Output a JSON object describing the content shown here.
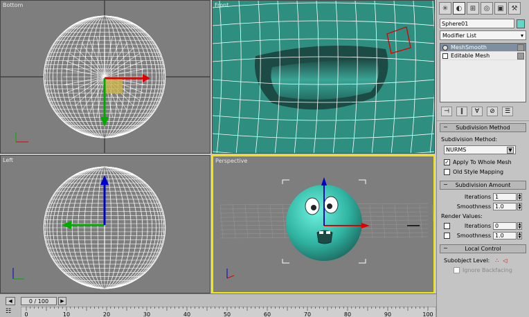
{
  "viewports": {
    "top_left": {
      "label": "Bottom"
    },
    "top_right": {
      "label": "Front"
    },
    "bottom_left": {
      "label": "Left"
    },
    "bottom_right": {
      "label": "Perspective"
    }
  },
  "panel": {
    "tabs": [
      "create-icon",
      "modify-icon",
      "hierarchy-icon",
      "motion-icon",
      "display-icon",
      "utilities-icon"
    ],
    "object_name": "Sphere01",
    "object_color": "#5fd8c8",
    "modifier_list": "Modifier List",
    "stack": [
      {
        "label": "MeshSmooth",
        "selected": true
      },
      {
        "label": "Editable Mesh",
        "selected": false
      }
    ],
    "subdivision_method": {
      "title": "Subdivision Method",
      "method_label": "Subdivision Method:",
      "method_value": "NURMS",
      "apply_whole_mesh": "Apply To Whole Mesh",
      "old_style": "Old Style Mapping"
    },
    "subdivision_amount": {
      "title": "Subdivision Amount",
      "iterations_label": "Iterations",
      "iterations_value": "1",
      "smoothness_label": "Smoothness",
      "smoothness_value": "1.0",
      "render_values": "Render Values:",
      "r_iterations_label": "Iterations",
      "r_iterations_value": "0",
      "r_smoothness_label": "Smoothness",
      "r_smoothness_value": "1.0"
    },
    "local_control": {
      "title": "Local Control",
      "subobject_label": "Subobject Level:",
      "ignore_backfacing": "Ignore Backfacing"
    }
  },
  "timeline": {
    "frame": "0 / 100",
    "ticks": [
      "0",
      "10",
      "20",
      "30",
      "40",
      "50",
      "60",
      "70",
      "80",
      "90",
      "100"
    ]
  },
  "colors": {
    "viewport_bg": "#7e7e7e",
    "teal": "#2d8d80",
    "active_border": "#f2e800"
  }
}
